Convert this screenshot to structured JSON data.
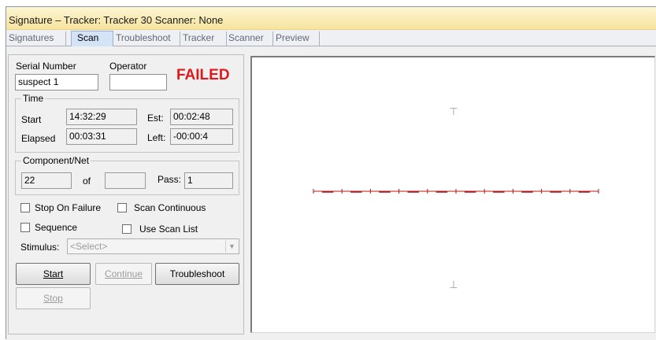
{
  "window": {
    "title": "Signature – Tracker: Tracker 30  Scanner: None"
  },
  "tabs": [
    {
      "label": "Signatures",
      "active": false
    },
    {
      "label": "Scan",
      "active": true
    },
    {
      "label": "Troubleshoot",
      "active": false
    },
    {
      "label": "Tracker",
      "active": false
    },
    {
      "label": "Scanner",
      "active": false
    },
    {
      "label": "Preview",
      "active": false
    }
  ],
  "scan": {
    "serial_number_label": "Serial Number",
    "serial_number_value": "suspect 1",
    "operator_label": "Operator",
    "operator_value": "",
    "status": "FAILED",
    "status_color": "#e0191e",
    "time": {
      "group_label": "Time",
      "start_label": "Start",
      "start_value": "14:32:29",
      "est_label": "Est:",
      "est_value": "00:02:48",
      "elapsed_label": "Elapsed",
      "elapsed_value": "00:03:31",
      "left_label": "Left:",
      "left_value": "-00:00:4"
    },
    "component": {
      "group_label": "Component/Net",
      "current_value": "22",
      "of_label": "of",
      "total_value": "",
      "pass_label": "Pass:",
      "pass_value": "1"
    },
    "options": {
      "stop_on_failure": "Stop On Failure",
      "scan_continuous": "Scan Continuous",
      "sequence": "Sequence",
      "use_scan_list": "Use Scan List"
    },
    "stimulus_label": "Stimulus:",
    "stimulus_value": "<Select>",
    "buttons": {
      "start": "Start",
      "continue": "Continue",
      "troubleshoot": "Troubleshoot",
      "stop": "Stop"
    }
  },
  "plot": {
    "trace_color": "#b01818",
    "axis_color": "#9a9a9a",
    "top_marker": "⊤",
    "bottom_marker": "⊥"
  }
}
